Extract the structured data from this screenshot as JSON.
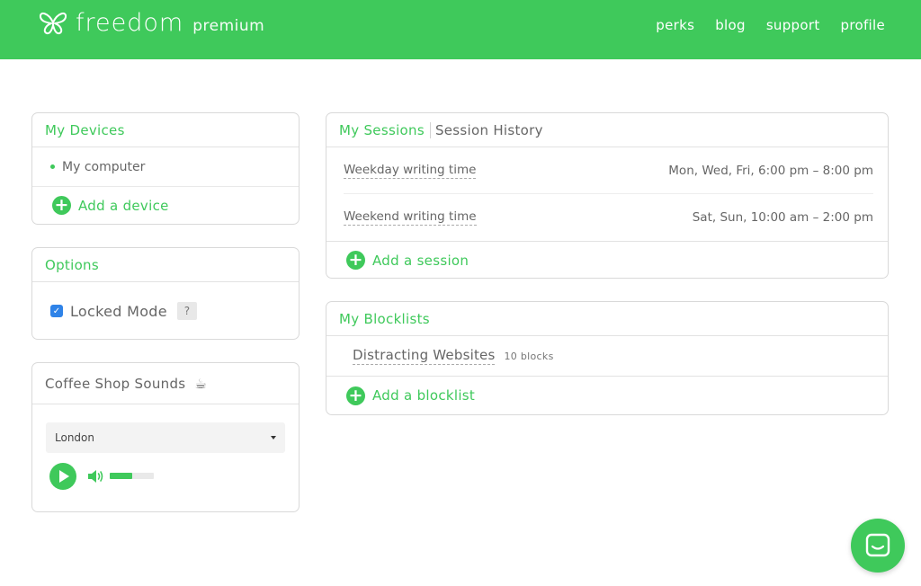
{
  "header": {
    "logo_word": "freedom",
    "logo_sub": "premium",
    "nav": [
      "perks",
      "blog",
      "support",
      "profile"
    ]
  },
  "devices": {
    "title": "My Devices",
    "items": [
      "My computer"
    ],
    "add_label": "Add a device"
  },
  "options": {
    "title": "Options",
    "locked_mode_label": "Locked Mode",
    "locked_mode_checked": true,
    "help": "?"
  },
  "coffee": {
    "title": "Coffee Shop Sounds",
    "selected_location": "London",
    "volume": 0.5
  },
  "sessions": {
    "tab_active": "My Sessions",
    "tab_other": "Session History",
    "items": [
      {
        "name": "Weekday writing time",
        "schedule": "Mon, Wed, Fri, 6:00 pm – 8:00 pm"
      },
      {
        "name": "Weekend writing time",
        "schedule": "Sat, Sun, 10:00 am – 2:00 pm"
      }
    ],
    "add_label": "Add a session"
  },
  "blocklists": {
    "title": "My Blocklists",
    "items": [
      {
        "name": "Distracting Websites",
        "count": "10 blocks"
      }
    ],
    "add_label": "Add a blocklist"
  },
  "colors": {
    "brand": "#3fc95b",
    "checkbox": "#2f83e8"
  }
}
